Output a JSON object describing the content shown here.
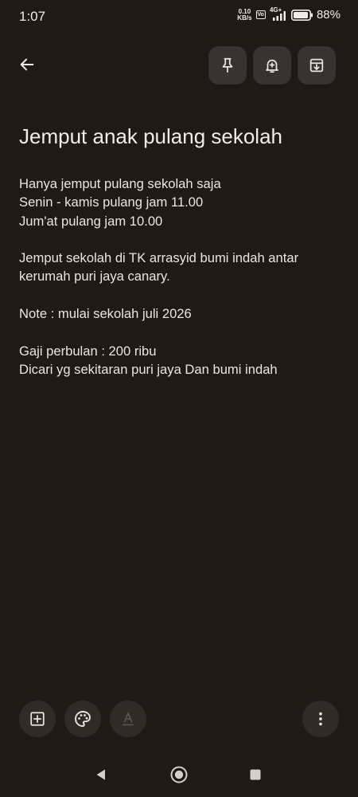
{
  "status_bar": {
    "time": "1:07",
    "net_speed_value": "0.10",
    "net_speed_unit": "KB/s",
    "volte_label": "Vo",
    "network_type": "4G+",
    "battery": "88%"
  },
  "toolbar": {
    "back_icon": "arrow-left-icon",
    "pin_icon": "pin-icon",
    "reminder_icon": "bell-plus-icon",
    "archive_icon": "archive-icon"
  },
  "note": {
    "title": "Jemput anak pulang sekolah",
    "lines": [
      "Hanya jemput pulang sekolah saja",
      "Senin - kamis pulang jam 11.00",
      "Jum'at pulang jam 10.00",
      "",
      "Jemput sekolah di TK arrasyid bumi indah antar",
      "kerumah puri jaya canary.",
      "",
      "Note : mulai sekolah juli 2026",
      "",
      "Gaji perbulan : 200 ribu",
      "Dicari yg sekitaran puri jaya Dan bumi indah"
    ]
  },
  "bottom_toolbar": {
    "add_icon": "add-box-icon",
    "palette_icon": "palette-icon",
    "text_format_icon": "text-format-icon",
    "more_icon": "more-vertical-icon"
  },
  "navigation": {
    "back": "triangle-back-icon",
    "home": "circle-home-icon",
    "recents": "square-recents-icon"
  },
  "colors": {
    "background": "#201a17",
    "button_background": "#3a3230",
    "text": "#ece4df"
  }
}
